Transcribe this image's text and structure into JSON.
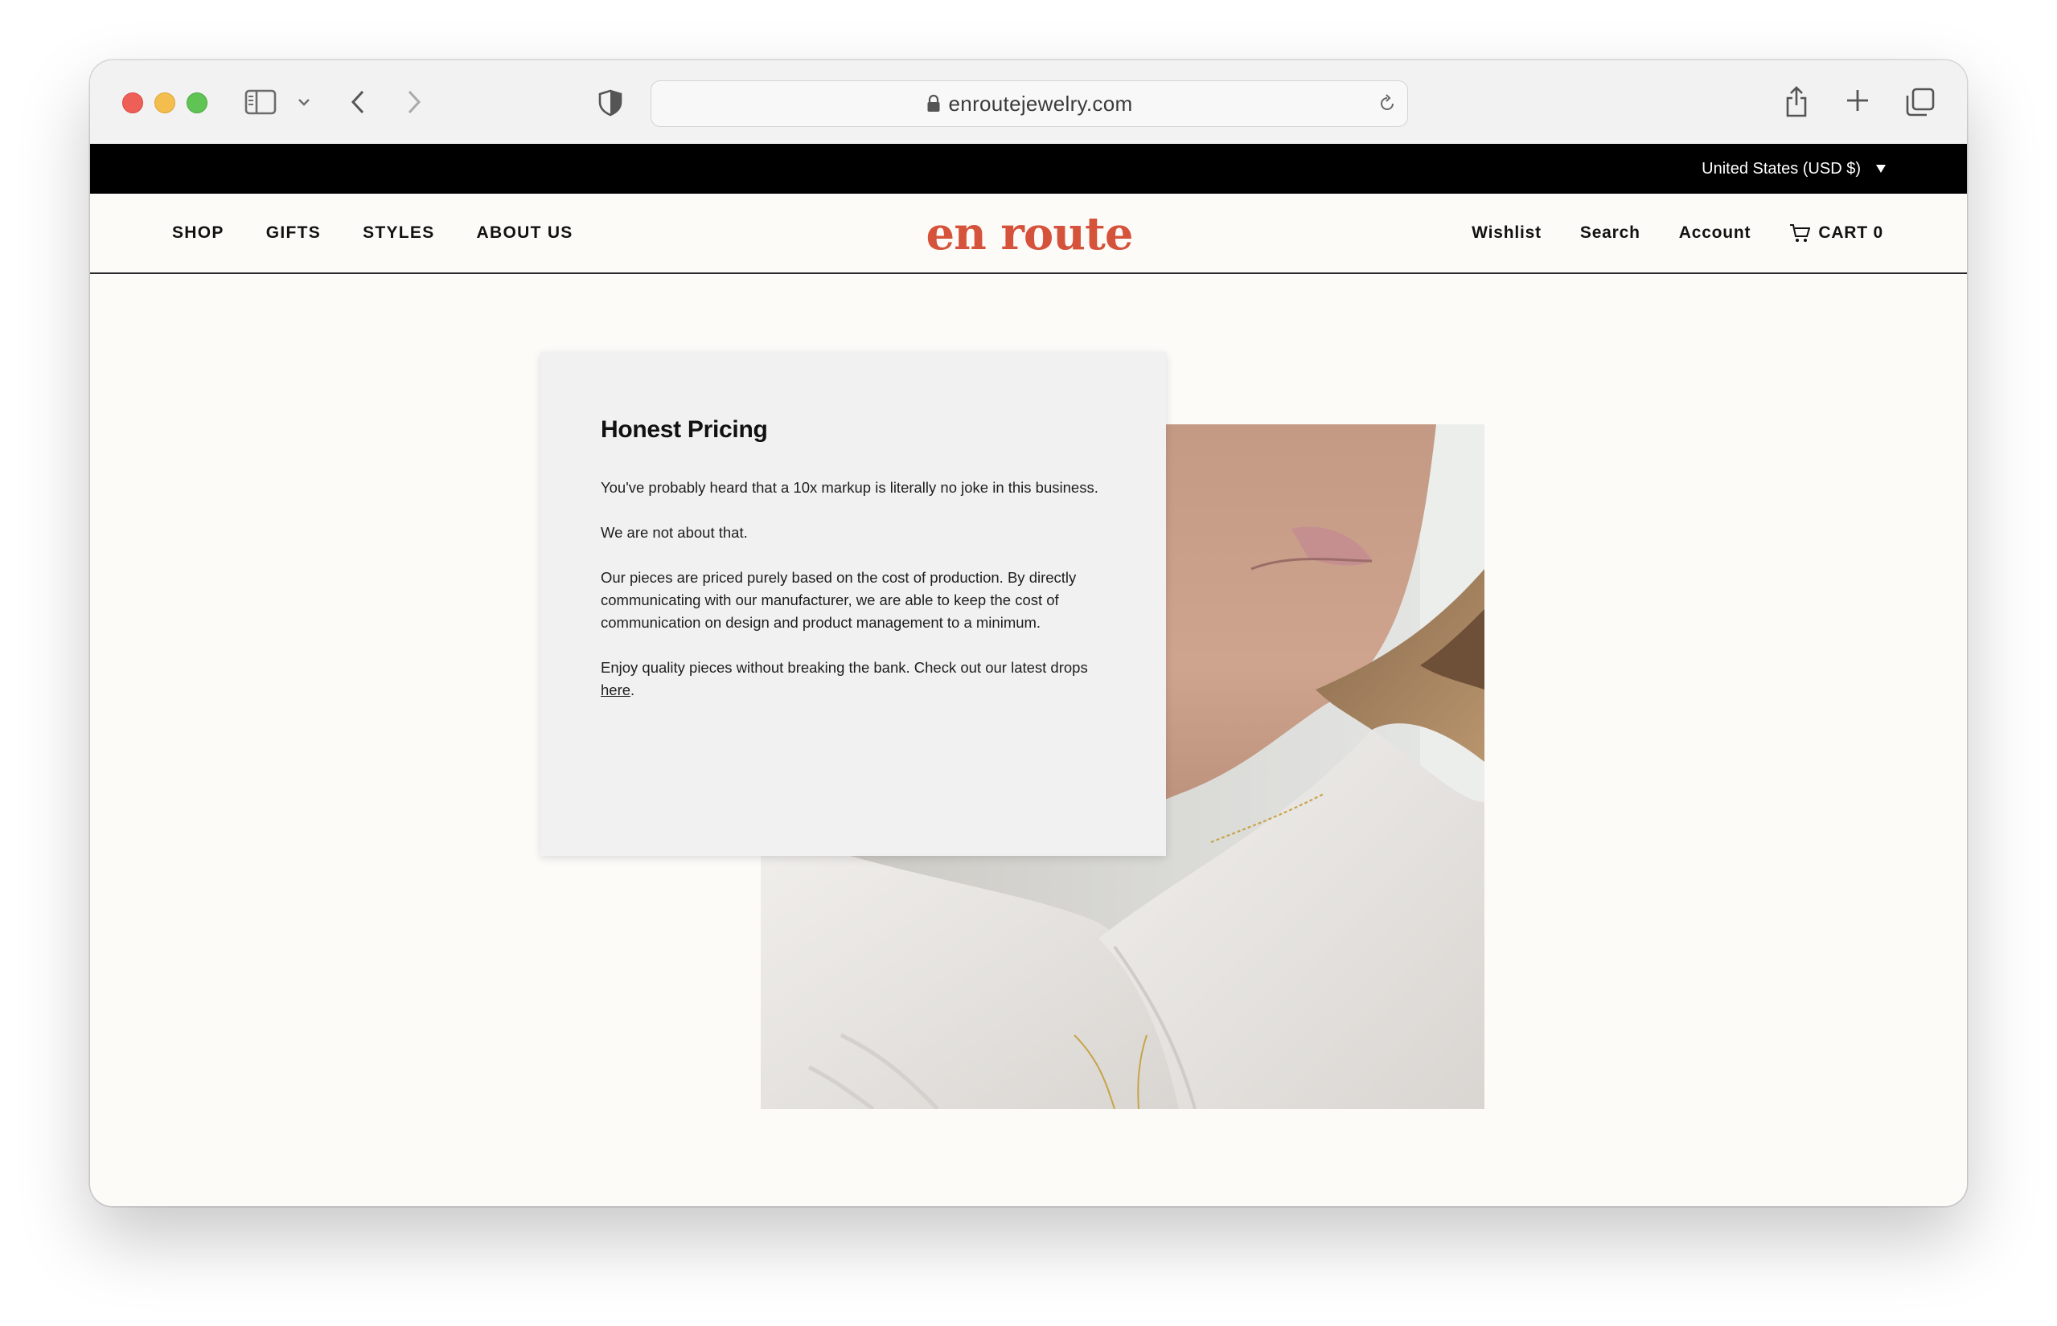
{
  "browser": {
    "url": "enroutejewelry.com"
  },
  "announcement": {
    "region": "United States (USD $)"
  },
  "header": {
    "logo": "en route",
    "nav_left": [
      "SHOP",
      "GIFTS",
      "STYLES",
      "ABOUT US"
    ],
    "wishlist": "Wishlist",
    "search": "Search",
    "account": "Account",
    "cart": "CART 0"
  },
  "content": {
    "title": "Honest Pricing",
    "p1": "You've probably heard that a 10x markup is literally no joke in this business.",
    "p2": "We are not about that.",
    "p3": "Our pieces are priced purely based on the cost of production. By directly communicating with our manufacturer, we are able to keep the cost of communication on design and product management to a minimum.",
    "p4_before": "Enjoy quality pieces without breaking the bank. Check out our latest drops ",
    "p4_link": "here",
    "p4_after": "."
  },
  "colors": {
    "brand": "#d6533b",
    "page_bg": "#fdfbf8",
    "card_bg": "#f1f1f1",
    "topbar": "#000000"
  },
  "icons": {
    "sidebar": "sidebar-icon",
    "back": "chevron-left-icon",
    "forward": "chevron-right-icon",
    "shield": "shield-icon",
    "lock": "lock-icon",
    "reload": "reload-icon",
    "share": "share-icon",
    "new_tab": "plus-icon",
    "tabs": "tabs-icon",
    "cart": "cart-icon"
  }
}
